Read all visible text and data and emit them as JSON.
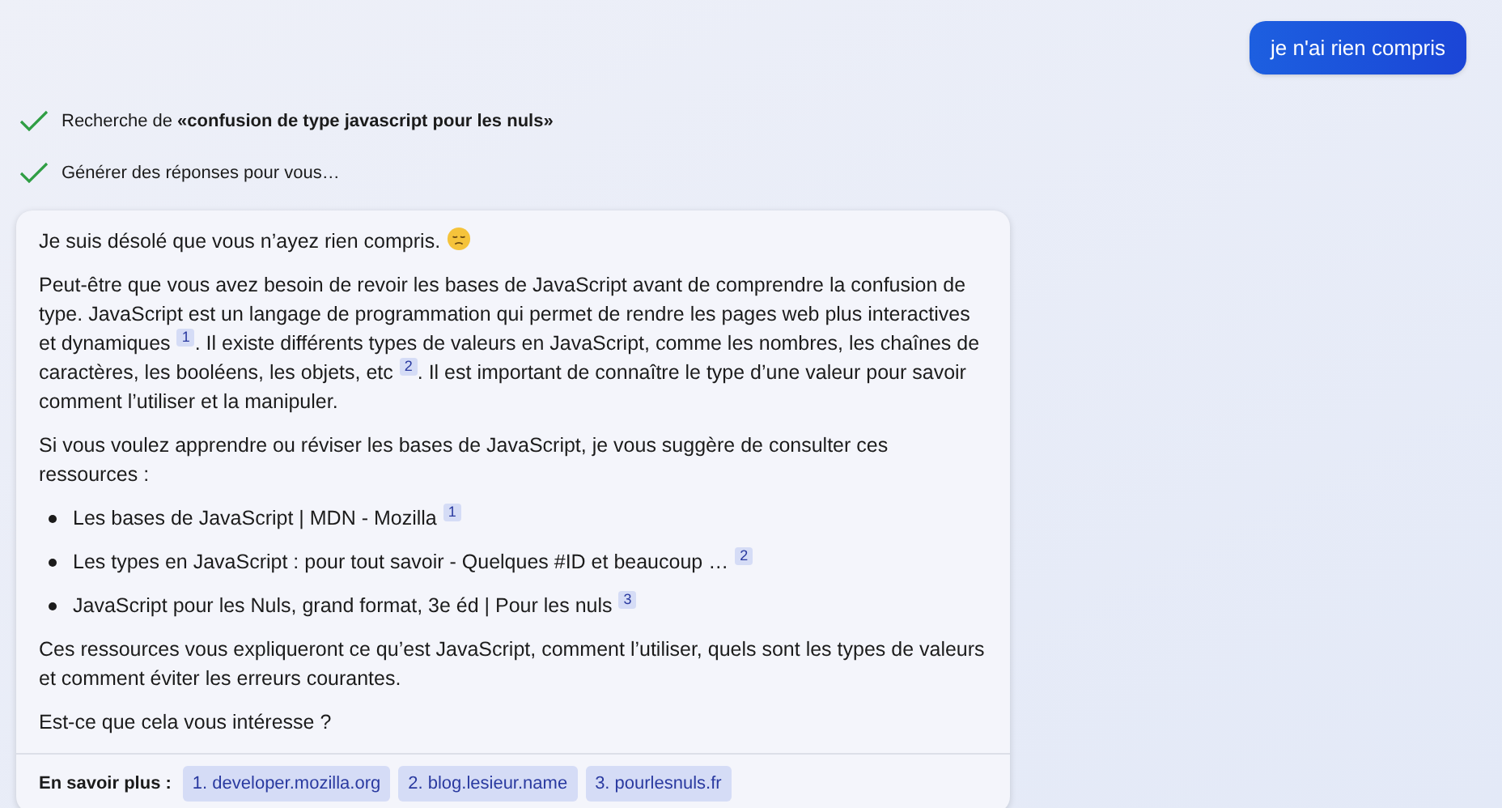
{
  "user_message": {
    "text": "je n'ai rien compris"
  },
  "progress": [
    {
      "text": "Recherche de **«confusion de type javascript pour les nuls»**",
      "done": true
    },
    {
      "text": "Générer des réponses pour vous…",
      "done": true
    }
  ],
  "answer": {
    "blocks": [
      {
        "kind": "paragraph",
        "parts": [
          {
            "text": "Je suis désolé que vous n’ayez rien compris."
          },
          {
            "kind": "emoji"
          }
        ]
      },
      {
        "kind": "paragraph",
        "parts": [
          {
            "text": "Peut-être que vous avez besoin de revoir les bases de JavaScript avant de comprendre la confusion de type. JavaScript est un langage de programmation qui permet de rendre les pages web plus interactives et dynamiques"
          },
          {
            "ref": "1"
          },
          {
            "text": ". Il existe différents types de valeurs en JavaScript, comme les nombres, les chaînes de caractères, les booléens, les objets, etc"
          },
          {
            "ref": "2"
          },
          {
            "text": ". Il est important de connaître le type d’une valeur pour savoir comment l’utiliser et la manipuler."
          }
        ]
      },
      {
        "kind": "paragraph",
        "parts": [
          {
            "text": "Si vous voulez apprendre ou réviser les bases de JavaScript, je vous suggère de consulter ces ressources :"
          }
        ]
      },
      {
        "kind": "list",
        "items": [
          {
            "parts": [
              {
                "text": "Les bases de JavaScript | MDN - Mozilla"
              },
              {
                "ref": "1"
              }
            ]
          },
          {
            "parts": [
              {
                "text": "Les types en JavaScript : pour tout savoir - Quelques #ID et beaucoup …"
              },
              {
                "ref": "2"
              }
            ]
          },
          {
            "parts": [
              {
                "text": "JavaScript pour les Nuls, grand format, 3e éd | Pour les nuls"
              },
              {
                "ref": "3"
              }
            ]
          }
        ]
      },
      {
        "kind": "paragraph",
        "parts": [
          {
            "text": "Ces ressources vous expliqueront ce qu’est JavaScript, comment l’utiliser, quels sont les types de valeurs et comment éviter les erreurs courantes."
          }
        ]
      },
      {
        "kind": "paragraph",
        "parts": [
          {
            "text": "Est-ce que cela vous intéresse ?"
          }
        ]
      }
    ],
    "learn_more": {
      "label": "En savoir plus :",
      "links": [
        "1. developer.mozilla.org",
        "2. blog.lesieur.name",
        "3. pourlesnuls.fr"
      ]
    }
  }
}
